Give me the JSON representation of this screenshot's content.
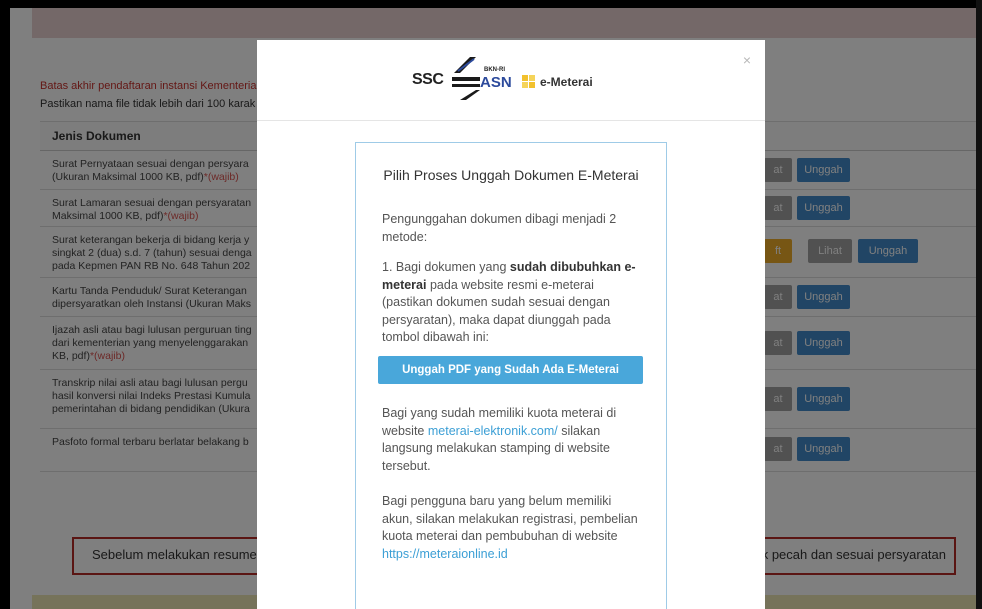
{
  "background": {
    "deadline_notice": "Batas akhir pendaftaran instansi Kementeria",
    "filename_notice": "Pastikan nama file tidak lebih dari 100 karak",
    "table_header": "Jenis Dokumen",
    "rows": [
      {
        "line1": "Surat Pernyataan sesuai dengan persyara",
        "line2": "(Ukuran Maksimal 1000 KB, pdf)",
        "required": "*(wajib)",
        "line3": "",
        "lihat": "at",
        "upload": "Unggah"
      },
      {
        "line1": "Surat Lamaran sesuai dengan persyaratan",
        "line2": "Maksimal 1000 KB, pdf)",
        "required": "*(wajib)",
        "line3": "",
        "lihat": "at",
        "upload": "Unggah"
      },
      {
        "line1": "Surat keterangan bekerja di bidang kerja y",
        "line2": "singkat 2 (dua) s.d. 7 (tahun) sesuai denga",
        "line3": "pada Kepmen PAN RB No. 648 Tahun 202",
        "required": "",
        "warn": "ft",
        "lihat": "Lihat",
        "upload": "Unggah"
      },
      {
        "line1": "Kartu Tanda Penduduk/ Surat Keterangan",
        "line2": "dipersyaratkan oleh Instansi (Ukuran Maks",
        "line3": "",
        "required": "",
        "lihat": "at",
        "upload": "Unggah"
      },
      {
        "line1": "Ijazah asli atau bagi lulusan perguruan ting",
        "line2": "dari kementerian yang menyelenggarakan",
        "line3": "KB, pdf)",
        "required": "*(wajib)",
        "lihat": "at",
        "upload": "Unggah"
      },
      {
        "line1": "Transkrip nilai asli atau bagi lulusan pergu",
        "line2": "hasil konversi nilai Indeks Prestasi Kumula",
        "line3": "pemerintahan di bidang pendidikan (Ukura",
        "required": "",
        "lihat": "at",
        "upload": "Unggah"
      },
      {
        "line1": "Pasfoto formal terbaru berlatar belakang b",
        "line2": "",
        "line3": "",
        "required": "",
        "lihat": "at",
        "upload": "Unggah"
      }
    ],
    "resume_left": "Sebelum melakukan resume, r",
    "resume_right": "ak pecah dan sesuai persyaratan"
  },
  "modal": {
    "close_symbol": "×",
    "logo": {
      "ssc": "SSC",
      "bkn": "BKN-RI",
      "asn": "ASN",
      "emeterai": "e-Meterai"
    },
    "title": "Pilih Proses Unggah Dokumen E-Meterai",
    "intro": "Pengunggahan dokumen dibagi menjadi 2 metode:",
    "method1": {
      "prefix": "1. Bagi dokumen yang ",
      "bold1": "sudah dibubuhkan e-meterai",
      "rest": " pada website resmi e-meterai (pastikan dokumen sudah sesuai dengan persyaratan), maka dapat diunggah pada tombol dibawah ini:"
    },
    "upload_button": "Unggah PDF yang Sudah Ada E-Meterai",
    "quota": {
      "prefix": "Bagi yang sudah memiliki kuota meterai di website ",
      "link": "meterai-elektronik.com/",
      "rest": " silakan langsung melakukan stamping di website tersebut."
    },
    "newuser": {
      "prefix": "Bagi pengguna baru yang belum memiliki akun, silakan melakukan registrasi, pembelian kuota meterai dan pembubuhan di website ",
      "link": "https://meteraionline.id"
    }
  },
  "colors": {
    "primary_button": "#428bca",
    "modal_upload": "#49a7da",
    "required_text": "#d9534f"
  }
}
